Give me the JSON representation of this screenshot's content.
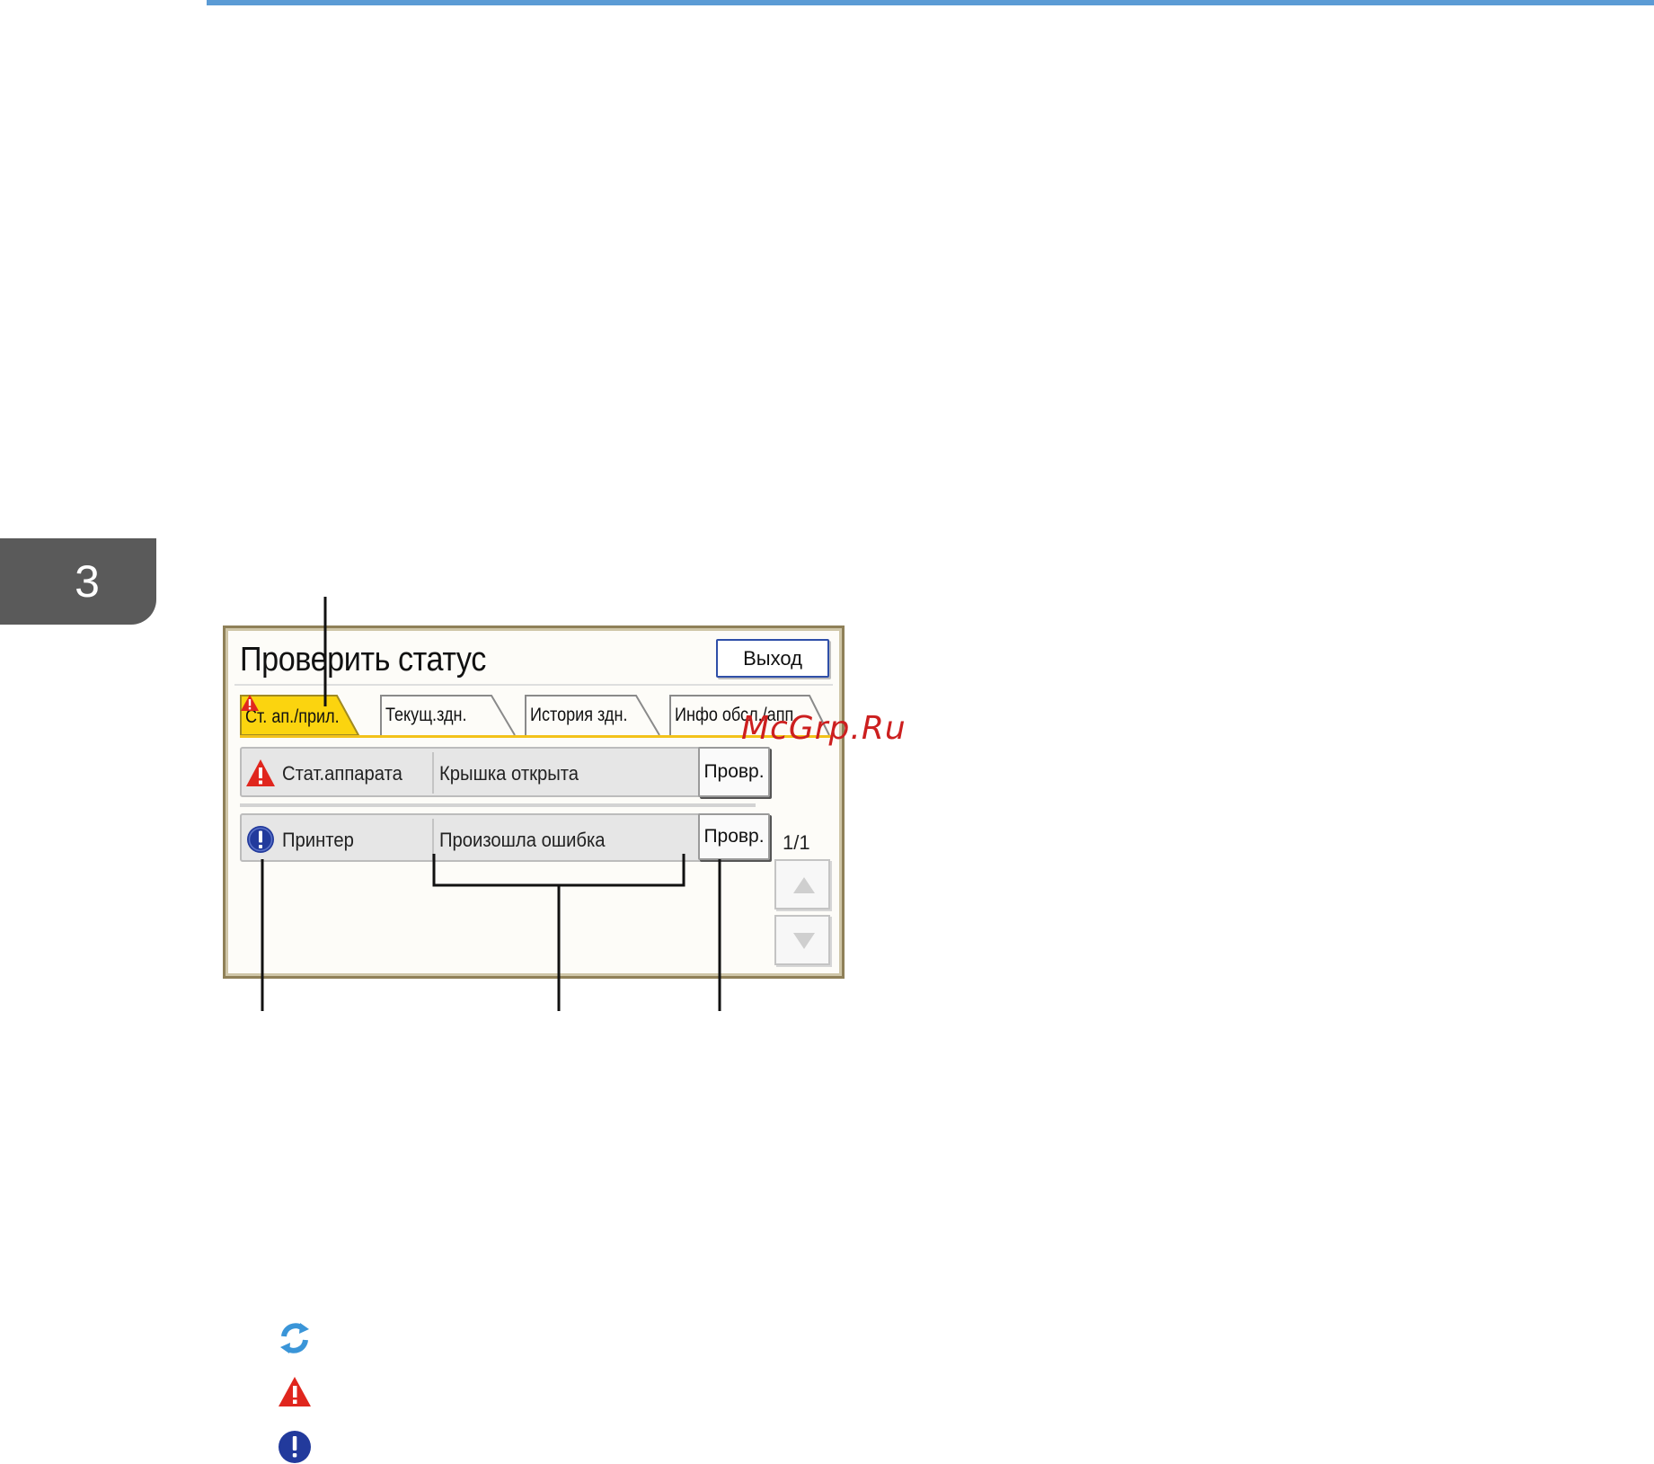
{
  "page": {
    "chapter_number": "3"
  },
  "panel": {
    "title": "Проверить статус",
    "exit_label": "Выход",
    "tabs": [
      {
        "label": "Ст. ап./прил.",
        "active": true,
        "warning": true
      },
      {
        "label": "Текущ.здн.",
        "active": false
      },
      {
        "label": "История здн.",
        "active": false
      },
      {
        "label": "Инфо обсл./апп.",
        "active": false
      }
    ],
    "rows": [
      {
        "icon": "warning-icon",
        "name": "Стат.аппарата",
        "message": "Крышка открыта",
        "button": "Провр."
      },
      {
        "icon": "info-icon",
        "name": "Принтер",
        "message": "Произошла ошибка",
        "button": "Провр."
      }
    ],
    "page_count": "1/1",
    "colors": {
      "active_tab": "#fbd40f",
      "warning": "#e0261e",
      "info": "#223a9c",
      "border": "#8f8058"
    }
  },
  "watermark": "McGrp.Ru",
  "legend": [
    {
      "icon": "refresh-icon"
    },
    {
      "icon": "warning-icon"
    },
    {
      "icon": "info-icon"
    }
  ]
}
